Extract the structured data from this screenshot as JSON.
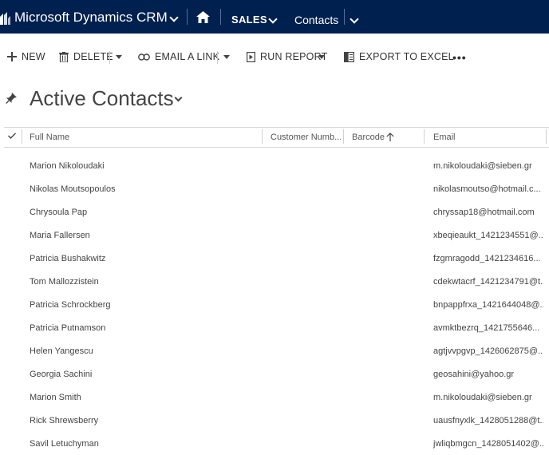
{
  "nav": {
    "app_title": "Microsoft Dynamics CRM",
    "area": "SALES",
    "entity": "Contacts",
    "bar_color": "#002050"
  },
  "commands": {
    "new": "NEW",
    "delete": "DELETE",
    "email_link": "EMAIL A LINK",
    "run_report": "RUN REPORT",
    "export": "EXPORT TO EXCEL",
    "more": "•••"
  },
  "view": {
    "title": "Active Contacts"
  },
  "grid": {
    "columns": [
      "Full Name",
      "Customer Numb...",
      "Barcode",
      "Email"
    ],
    "sorted_column": "Barcode",
    "sort_direction": "ascending",
    "rows": [
      {
        "name": "Marion Nikoloudaki",
        "email": "m.nikoloudaki@sieben.gr"
      },
      {
        "name": "Nikolas Moutsopoulos",
        "email": "nikolasmoutso@hotmail.c..."
      },
      {
        "name": "Chrysoula Pap",
        "email": "chryssap18@hotmail.com"
      },
      {
        "name": "Maria Fallersen",
        "email": "xbeqieaukt_1421234551@..."
      },
      {
        "name": "Patricia Bushakwitz",
        "email": "fzgmragodd_1421234616..."
      },
      {
        "name": "Tom Mallozzistein",
        "email": "cdekwtacrf_1421234791@t..."
      },
      {
        "name": "Patricia Schrockberg",
        "email": "bnpappfrxa_1421644048@..."
      },
      {
        "name": "Patricia Putnamson",
        "email": "avmktbezrq_1421755646..."
      },
      {
        "name": "Helen Yangescu",
        "email": "agtjvvpgvp_1426062875@..."
      },
      {
        "name": "Georgia Sachini",
        "email": "geosahini@yahoo.gr"
      },
      {
        "name": "Marion Smith",
        "email": "m.nikoloudaki@sieben.gr"
      },
      {
        "name": "Rick Shrewsberry",
        "email": "uausfnyxlk_1428051288@t..."
      },
      {
        "name": "Savil Letuchyman",
        "email": "jwliqbmgcn_1428051402@..."
      }
    ]
  }
}
